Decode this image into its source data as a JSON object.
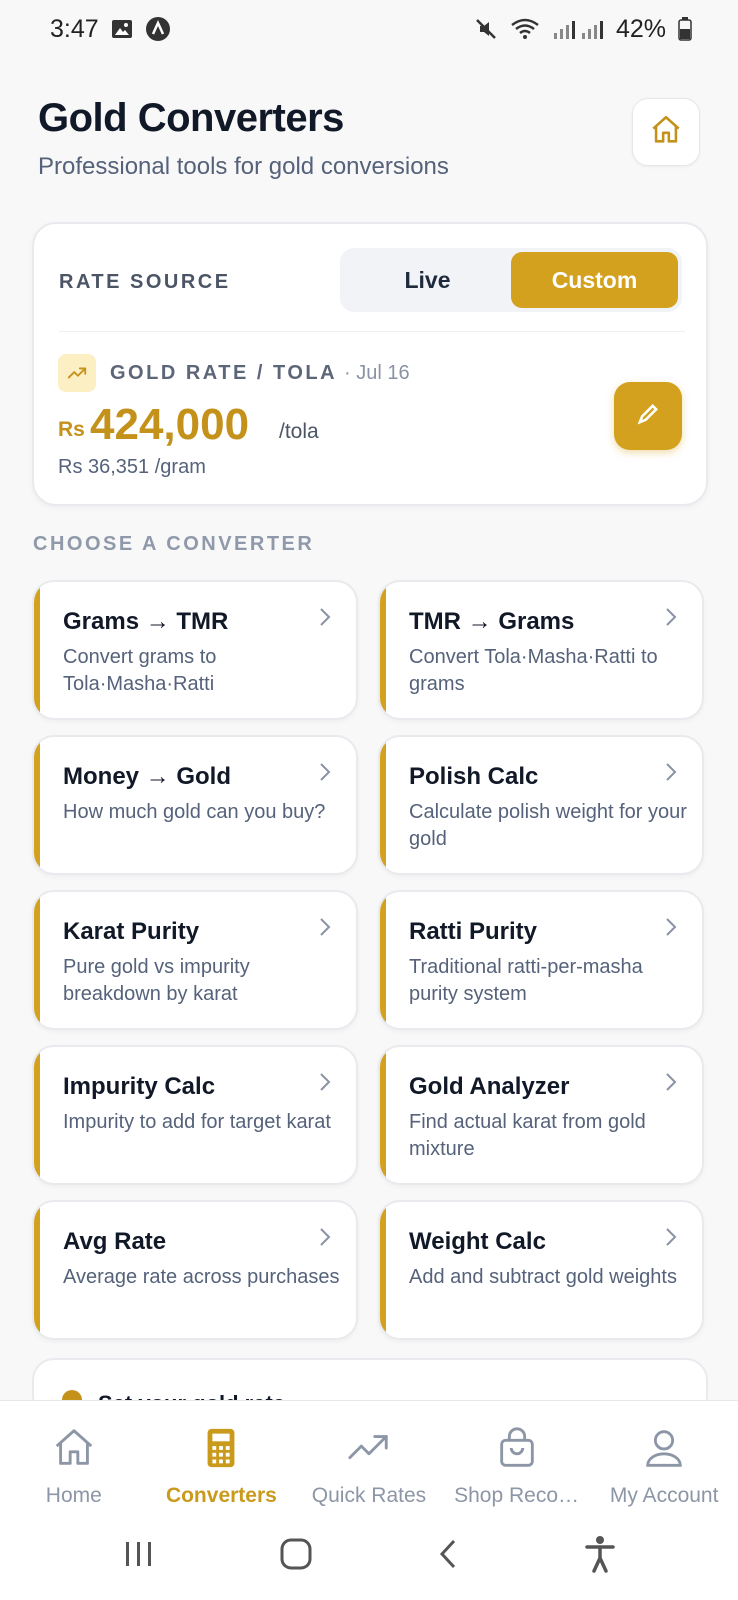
{
  "status_bar": {
    "time": "3:47",
    "battery": "42%",
    "icons": [
      "gallery-icon",
      "app-notification-icon",
      "mute-icon",
      "wifi-icon",
      "signal-icon",
      "battery-icon"
    ]
  },
  "header": {
    "title": "Gold Converters",
    "subtitle": "Professional tools for gold conversions",
    "home_icon": "home-icon"
  },
  "rate_card": {
    "source_label": "RATE SOURCE",
    "options": [
      "Live",
      "Custom"
    ],
    "selected": "Custom",
    "gold_rate_label": "GOLD RATE / TOLA",
    "date": "· Jul 16",
    "currency": "Rs",
    "value": "424,000",
    "unit": "/tola",
    "per_gram": "Rs 36,351 /gram",
    "edit_icon": "pencil-icon"
  },
  "section_title": "CHOOSE A CONVERTER",
  "converters": [
    {
      "title": "Grams → TMR",
      "desc": "Convert grams to Tola·Masha·Ratti"
    },
    {
      "title": "TMR → Grams",
      "desc": "Convert Tola·Masha·Ratti to grams"
    },
    {
      "title": "Money → Gold",
      "desc": "How much gold can you buy?"
    },
    {
      "title": "Polish Calc",
      "desc": "Calculate polish weight for your gold"
    },
    {
      "title": "Karat Purity",
      "desc": "Pure gold vs impurity breakdown by karat"
    },
    {
      "title": "Ratti Purity",
      "desc": "Traditional ratti-per-masha purity system"
    },
    {
      "title": "Impurity Calc",
      "desc": "Impurity to add for target karat"
    },
    {
      "title": "Gold Analyzer",
      "desc": "Find actual karat from gold mixture"
    },
    {
      "title": "Avg Rate",
      "desc": "Average rate across purchases"
    },
    {
      "title": "Weight Calc",
      "desc": "Add and subtract gold weights"
    }
  ],
  "partial_card": {
    "text": "Set your gold rate"
  },
  "bottom_nav": [
    {
      "label": "Home",
      "icon": "home-icon"
    },
    {
      "label": "Converters",
      "icon": "calculator-icon",
      "active": true
    },
    {
      "label": "Quick Rates",
      "icon": "trending-up-icon"
    },
    {
      "label": "Shop Reco…",
      "icon": "shopping-bag-icon"
    },
    {
      "label": "My Account",
      "icon": "user-icon"
    }
  ],
  "colors": {
    "accent": "#d4a11e",
    "accent_text": "#c4921a",
    "background": "#f8f8f8"
  }
}
